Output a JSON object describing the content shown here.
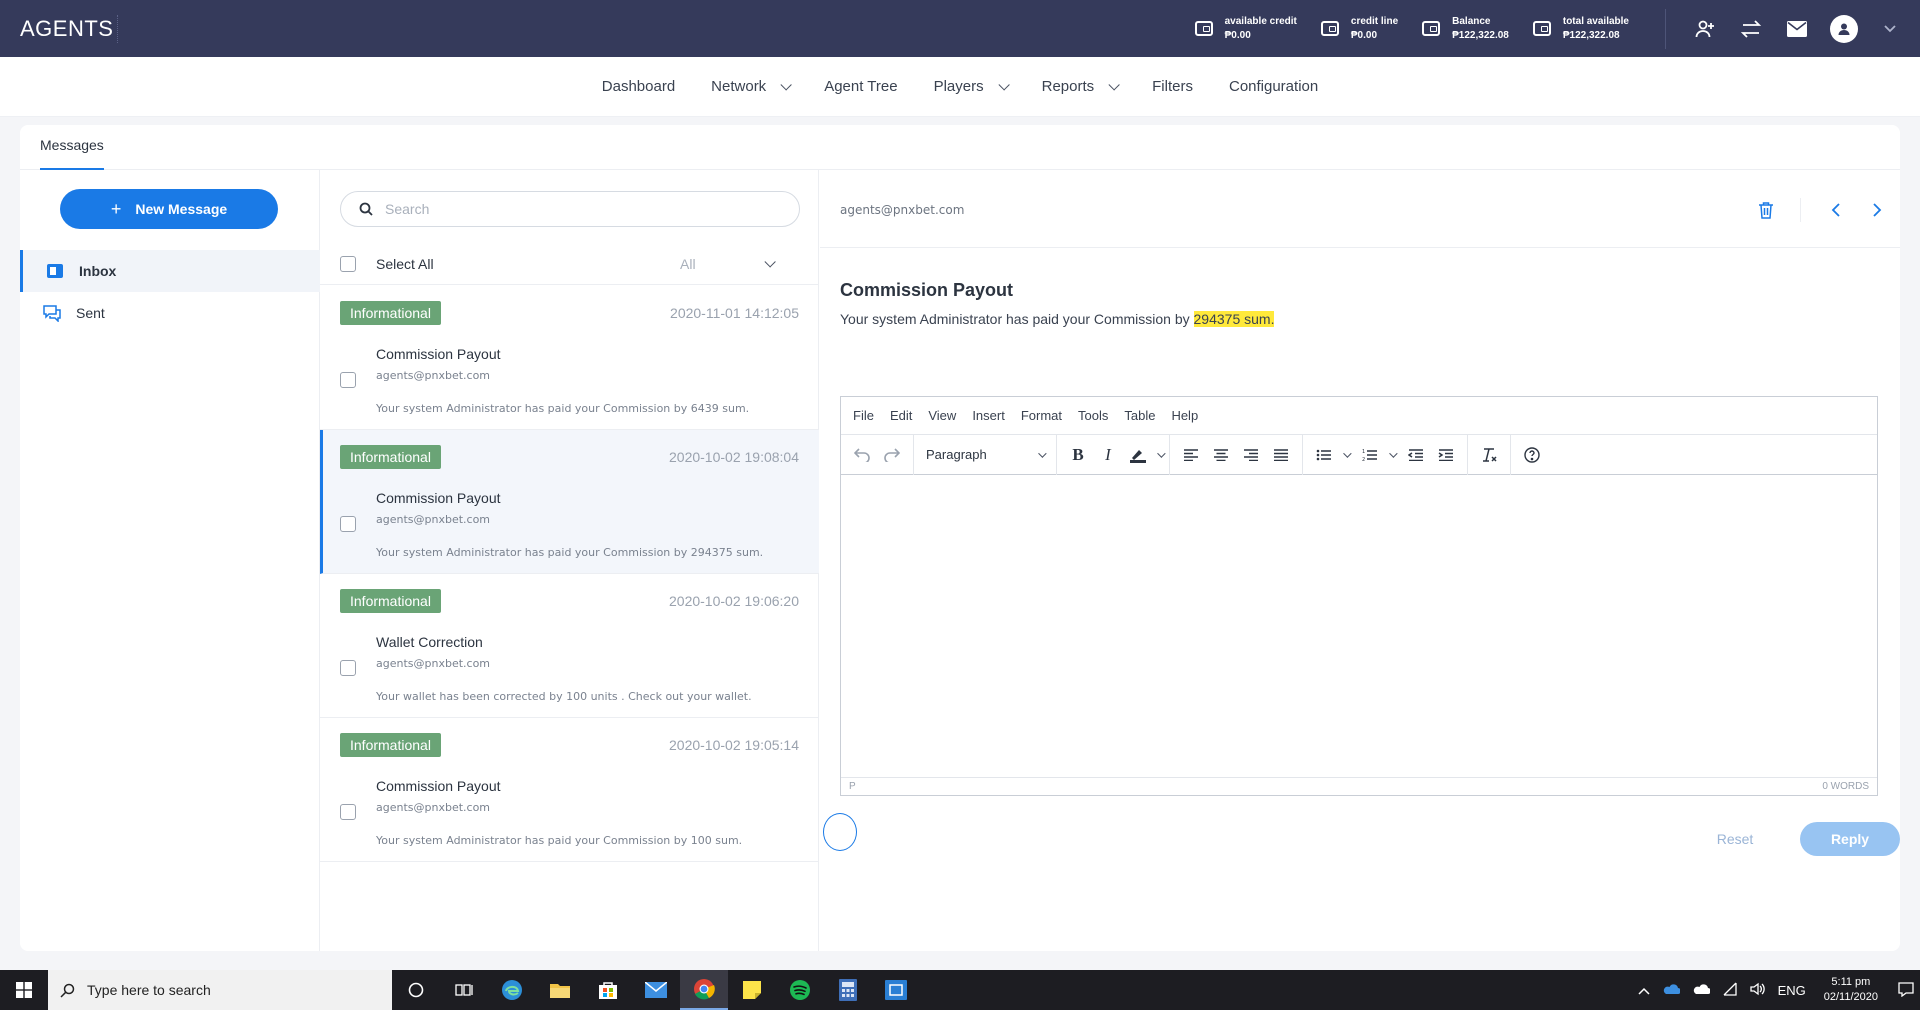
{
  "topbar": {
    "brand": "AGENTS",
    "stats": [
      {
        "label": "available credit",
        "value": "₱0.00"
      },
      {
        "label": "credit line",
        "value": "₱0.00"
      },
      {
        "label": "Balance",
        "value": "₱122,322.08"
      },
      {
        "label": "total available",
        "value": "₱122,322.08"
      }
    ],
    "icons": [
      "add-user-icon",
      "transfer-icon",
      "mail-icon",
      "avatar-icon",
      "chevron-down-icon"
    ]
  },
  "nav": {
    "items": [
      {
        "label": "Dashboard",
        "dropdown": false
      },
      {
        "label": "Network",
        "dropdown": true
      },
      {
        "label": "Agent Tree",
        "dropdown": false
      },
      {
        "label": "Players",
        "dropdown": true
      },
      {
        "label": "Reports",
        "dropdown": true
      },
      {
        "label": "Filters",
        "dropdown": false
      },
      {
        "label": "Configuration",
        "dropdown": false
      }
    ]
  },
  "page": {
    "tab": "Messages"
  },
  "sidebar": {
    "new_message": "New Message",
    "folders": [
      {
        "label": "Inbox",
        "active": true,
        "icon": "inbox-icon"
      },
      {
        "label": "Sent",
        "active": false,
        "icon": "chat-icon"
      }
    ]
  },
  "list": {
    "search_placeholder": "Search",
    "select_all": "Select All",
    "filter_value": "All",
    "messages": [
      {
        "badge": "Informational",
        "date": "2020-11-01 14:12:05",
        "subject": "Commission Payout",
        "from": "agents@pnxbet.com",
        "preview": "Your system Administrator has paid your Commission by 6439 sum.",
        "selected": false
      },
      {
        "badge": "Informational",
        "date": "2020-10-02 19:08:04",
        "subject": "Commission Payout",
        "from": "agents@pnxbet.com",
        "preview": "Your system Administrator has paid your Commission by 294375 sum.",
        "selected": true
      },
      {
        "badge": "Informational",
        "date": "2020-10-02 19:06:20",
        "subject": "Wallet Correction",
        "from": "agents@pnxbet.com",
        "preview": "Your wallet has been corrected by 100 units . Check out your wallet.",
        "selected": false
      },
      {
        "badge": "Informational",
        "date": "2020-10-02 19:05:14",
        "subject": "Commission Payout",
        "from": "agents@pnxbet.com",
        "preview": "Your system Administrator has paid your Commission by 100 sum.",
        "selected": false
      }
    ]
  },
  "detail": {
    "sender": "agents@pnxbet.com",
    "title": "Commission Payout",
    "body_prefix": "Your system Administrator has paid your Commission by ",
    "body_highlight": "294375 sum.",
    "editor": {
      "menu": [
        "File",
        "Edit",
        "View",
        "Insert",
        "Format",
        "Tools",
        "Table",
        "Help"
      ],
      "block_format": "Paragraph",
      "path": "P",
      "word_count": "0 WORDS"
    },
    "reset_label": "Reset",
    "reply_label": "Reply"
  },
  "taskbar": {
    "search_placeholder": "Type here to search",
    "language": "ENG",
    "time": "5:11 pm",
    "date": "02/11/2020"
  },
  "colors": {
    "topbar": "#353a5b",
    "accent": "#1a7ae6",
    "badge": "#6aa476",
    "highlight": "#ffe93b"
  }
}
